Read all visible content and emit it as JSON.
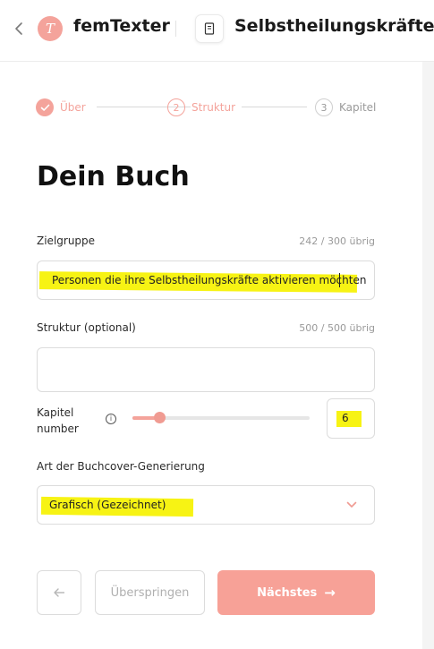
{
  "header": {
    "brand": "femTexter",
    "logo_letter": "T",
    "book_title": "Selbstheilungskräfte",
    "accent": "#f4a39b"
  },
  "steps": [
    {
      "number": "✓",
      "label": "Über",
      "state": "done"
    },
    {
      "number": "2",
      "label": "Struktur",
      "state": "active"
    },
    {
      "number": "3",
      "label": "Kapitel",
      "state": "pending"
    }
  ],
  "page": {
    "title": "Dein Buch"
  },
  "form": {
    "target_group": {
      "label": "Zielgruppe",
      "counter": "242 / 300 übrig",
      "value": "Personen die ihre Selbstheilungskräfte aktivieren möchten"
    },
    "structure": {
      "label": "Struktur (optional)",
      "counter": "500 / 500 übrig",
      "value": ""
    },
    "chapters": {
      "label_line1": "Kapitel",
      "label_line2": "number",
      "info_icon": "info-icon",
      "slider_fraction": 0.15,
      "value": "6"
    },
    "cover": {
      "label": "Art der Buchcover-Generierung",
      "selected": "Grafisch (Gezeichnet)"
    }
  },
  "buttons": {
    "back_icon": "arrow-left-icon",
    "skip": "Überspringen",
    "next": "Nächstes",
    "next_arrow": "→"
  }
}
